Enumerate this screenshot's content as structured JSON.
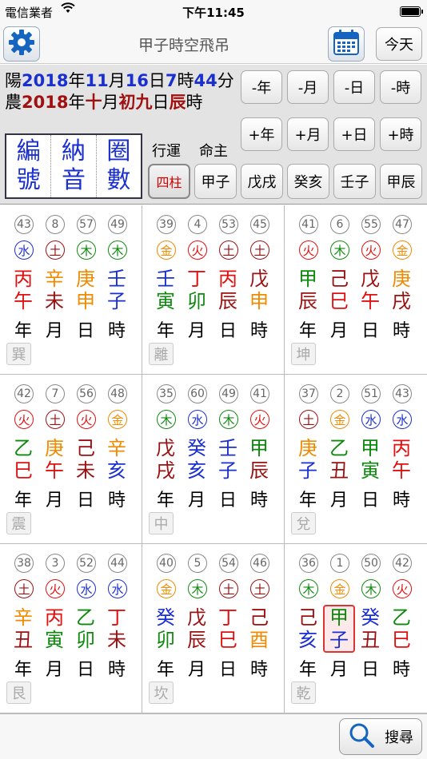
{
  "status": {
    "carrier": "電信業者",
    "time": "下午11:45"
  },
  "nav": {
    "title": "甲子時空飛吊",
    "today_label": "今天"
  },
  "solar": {
    "prefix": "陽",
    "year": "2018",
    "year_unit": "年",
    "month": "11",
    "month_unit": "月",
    "day": "16",
    "day_unit": "日",
    "hour": "7",
    "hour_unit": "時",
    "minute": "44",
    "minute_unit": "分"
  },
  "lunar": {
    "prefix": "農",
    "year": "2018",
    "year_unit": "年",
    "month": "十",
    "month_unit": "月",
    "day": "初九",
    "day_unit": "日",
    "hour": "辰",
    "hour_unit": "時"
  },
  "buttons": {
    "minus": [
      "-年",
      "-月",
      "-日",
      "-時"
    ],
    "plus": [
      "+年",
      "+月",
      "+日",
      "+時"
    ]
  },
  "mode_box": [
    {
      "top": "編",
      "bottom": "號"
    },
    {
      "top": "納",
      "bottom": "音"
    },
    {
      "top": "圈",
      "bottom": "數"
    }
  ],
  "labels": {
    "luck": "行運",
    "natal": "命主"
  },
  "pillar_buttons": [
    "四柱",
    "甲子",
    "戊戌",
    "癸亥",
    "壬子",
    "甲辰"
  ],
  "element_colors": {
    "水": "#1a2fd0",
    "火": "#e01010",
    "土": "#9b1010",
    "木": "#0d8a0d",
    "金": "#f08a00"
  },
  "pillar_labels": [
    "年",
    "月",
    "日",
    "時"
  ],
  "trigrams": [
    {
      "name": "巽",
      "cols": [
        {
          "num": "43",
          "el": "水",
          "stem": "丙",
          "branch": "午"
        },
        {
          "num": "8",
          "el": "土",
          "stem": "辛",
          "branch": "未"
        },
        {
          "num": "57",
          "el": "木",
          "stem": "庚",
          "branch": "申"
        },
        {
          "num": "49",
          "el": "木",
          "stem": "壬",
          "branch": "子"
        }
      ]
    },
    {
      "name": "離",
      "cols": [
        {
          "num": "39",
          "el": "金",
          "stem": "壬",
          "branch": "寅"
        },
        {
          "num": "4",
          "el": "火",
          "stem": "丁",
          "branch": "卯"
        },
        {
          "num": "53",
          "el": "土",
          "stem": "丙",
          "branch": "辰"
        },
        {
          "num": "45",
          "el": "土",
          "stem": "戊",
          "branch": "申"
        }
      ]
    },
    {
      "name": "坤",
      "cols": [
        {
          "num": "41",
          "el": "火",
          "stem": "甲",
          "branch": "辰"
        },
        {
          "num": "6",
          "el": "木",
          "stem": "己",
          "branch": "巳"
        },
        {
          "num": "55",
          "el": "火",
          "stem": "戊",
          "branch": "午"
        },
        {
          "num": "47",
          "el": "金",
          "stem": "庚",
          "branch": "戌"
        }
      ]
    },
    {
      "name": "震",
      "cols": [
        {
          "num": "42",
          "el": "火",
          "stem": "乙",
          "branch": "巳"
        },
        {
          "num": "7",
          "el": "土",
          "stem": "庚",
          "branch": "午"
        },
        {
          "num": "56",
          "el": "火",
          "stem": "己",
          "branch": "未"
        },
        {
          "num": "48",
          "el": "金",
          "stem": "辛",
          "branch": "亥"
        }
      ]
    },
    {
      "name": "中",
      "cols": [
        {
          "num": "35",
          "el": "木",
          "stem": "戊",
          "branch": "戌"
        },
        {
          "num": "60",
          "el": "水",
          "stem": "癸",
          "branch": "亥"
        },
        {
          "num": "49",
          "el": "木",
          "stem": "壬",
          "branch": "子"
        },
        {
          "num": "41",
          "el": "火",
          "stem": "甲",
          "branch": "辰"
        }
      ]
    },
    {
      "name": "兌",
      "cols": [
        {
          "num": "37",
          "el": "土",
          "stem": "庚",
          "branch": "子"
        },
        {
          "num": "2",
          "el": "金",
          "stem": "乙",
          "branch": "丑"
        },
        {
          "num": "51",
          "el": "水",
          "stem": "甲",
          "branch": "寅"
        },
        {
          "num": "43",
          "el": "水",
          "stem": "丙",
          "branch": "午"
        }
      ]
    },
    {
      "name": "艮",
      "cols": [
        {
          "num": "38",
          "el": "土",
          "stem": "辛",
          "branch": "丑"
        },
        {
          "num": "3",
          "el": "火",
          "stem": "丙",
          "branch": "寅"
        },
        {
          "num": "52",
          "el": "水",
          "stem": "乙",
          "branch": "卯"
        },
        {
          "num": "44",
          "el": "水",
          "stem": "丁",
          "branch": "未"
        }
      ]
    },
    {
      "name": "坎",
      "cols": [
        {
          "num": "40",
          "el": "金",
          "stem": "癸",
          "branch": "卯"
        },
        {
          "num": "5",
          "el": "木",
          "stem": "戊",
          "branch": "辰"
        },
        {
          "num": "54",
          "el": "土",
          "stem": "丁",
          "branch": "巳"
        },
        {
          "num": "46",
          "el": "土",
          "stem": "己",
          "branch": "酉"
        }
      ]
    },
    {
      "name": "乾",
      "cols": [
        {
          "num": "36",
          "el": "木",
          "stem": "己",
          "branch": "亥"
        },
        {
          "num": "1",
          "el": "金",
          "stem": "甲",
          "branch": "子",
          "highlight": true
        },
        {
          "num": "50",
          "el": "木",
          "stem": "癸",
          "branch": "丑"
        },
        {
          "num": "42",
          "el": "火",
          "stem": "乙",
          "branch": "巳"
        }
      ]
    }
  ],
  "search": {
    "label": "搜尋"
  }
}
